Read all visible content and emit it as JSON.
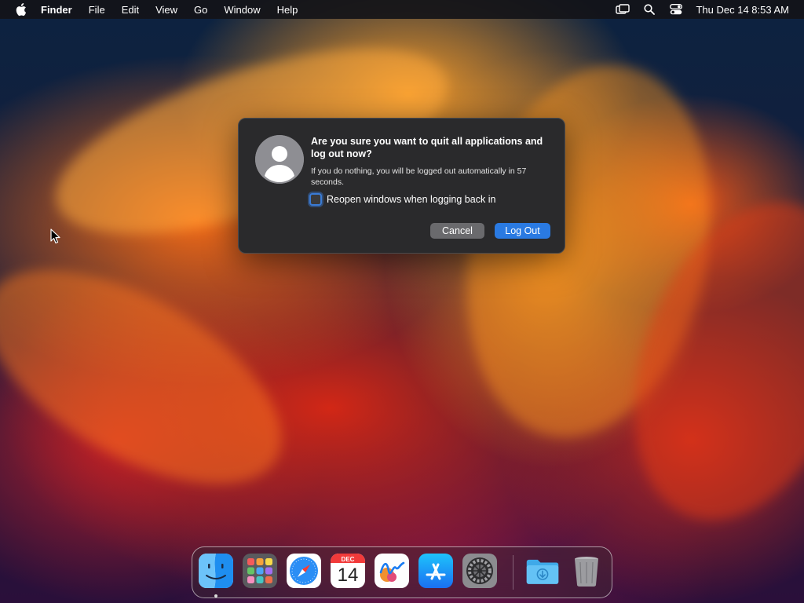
{
  "menubar": {
    "app_name": "Finder",
    "menus": [
      "File",
      "Edit",
      "View",
      "Go",
      "Window",
      "Help"
    ],
    "clock": "Thu Dec 14  8:53 AM",
    "status_icons": [
      "screen-mirroring-icon",
      "spotlight-search-icon",
      "control-center-icon"
    ]
  },
  "dialog": {
    "title": "Are you sure you want to quit all applications and log out now?",
    "message": "If you do nothing, you will be logged out automatically in 57 seconds.",
    "checkbox_label": "Reopen windows when logging back in",
    "checkbox_checked": false,
    "cancel_label": "Cancel",
    "logout_label": "Log Out",
    "accent_color": "#2a7ae2"
  },
  "dock": {
    "items": [
      {
        "name": "Finder",
        "icon": "finder-icon",
        "running": true
      },
      {
        "name": "Launchpad",
        "icon": "launchpad-icon",
        "running": false
      },
      {
        "name": "Safari",
        "icon": "safari-icon",
        "running": false
      },
      {
        "name": "Calendar",
        "icon": "calendar-icon",
        "running": false
      },
      {
        "name": "Freeform",
        "icon": "freeform-icon",
        "running": false
      },
      {
        "name": "App Store",
        "icon": "app-store-icon",
        "running": false
      },
      {
        "name": "System Settings",
        "icon": "system-settings-icon",
        "running": false
      },
      {
        "name": "Downloads",
        "icon": "downloads-folder-icon",
        "running": false
      },
      {
        "name": "Trash",
        "icon": "trash-icon",
        "running": false
      }
    ],
    "calendar_month": "DEC",
    "calendar_day": "14"
  }
}
